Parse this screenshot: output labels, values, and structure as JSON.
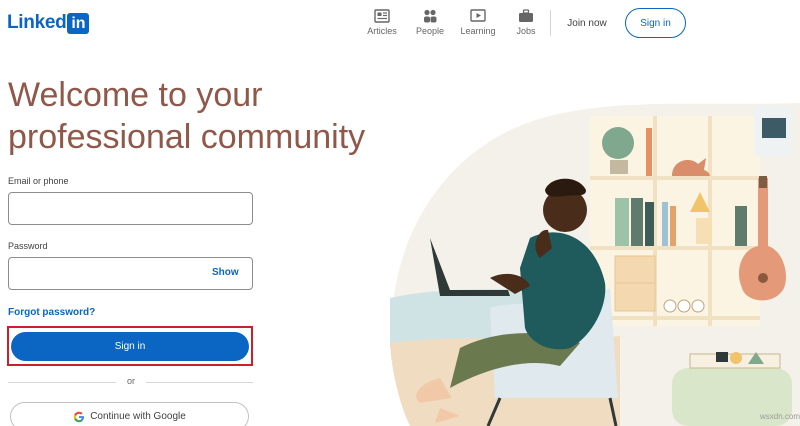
{
  "brand": {
    "logo_word": "Linked",
    "logo_box": "in",
    "logo_icon": "linkedin-logo"
  },
  "nav": {
    "items": [
      {
        "label": "Articles",
        "icon": "articles-icon"
      },
      {
        "label": "People",
        "icon": "people-icon"
      },
      {
        "label": "Learning",
        "icon": "learning-icon"
      },
      {
        "label": "Jobs",
        "icon": "jobs-icon"
      }
    ],
    "join_now": "Join now",
    "sign_in": "Sign in"
  },
  "hero": {
    "headline_line1": "Welcome to your",
    "headline_line2": "professional community"
  },
  "form": {
    "email_label": "Email or phone",
    "email_value": "",
    "password_label": "Password",
    "password_value": "",
    "show_label": "Show",
    "forgot_password": "Forgot password?",
    "sign_in_button": "Sign in",
    "or_text": "or",
    "google_button": "Continue with Google",
    "google_icon": "google-icon"
  },
  "colors": {
    "brand_blue": "#0a66c2",
    "headline": "#8f5849",
    "highlight_outline": "#c9202a"
  },
  "watermark": "wsxdn.com"
}
